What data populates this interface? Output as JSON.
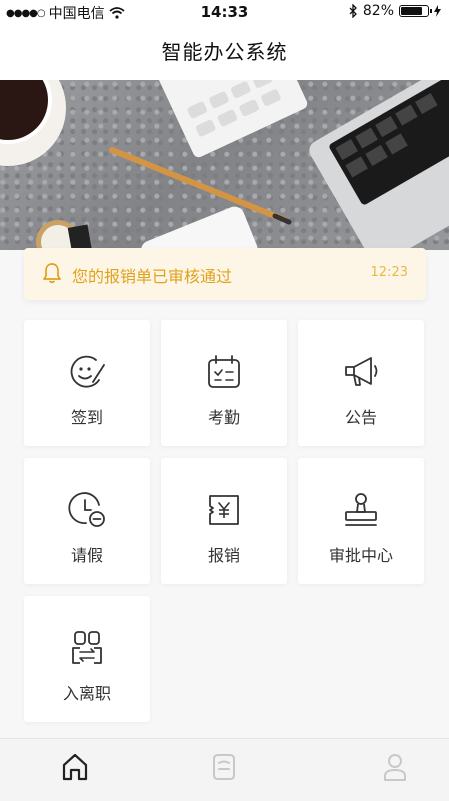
{
  "status_bar": {
    "carrier": "中国电信",
    "time": "14:33",
    "battery_percent": "82%",
    "battery_level": 0.82
  },
  "nav": {
    "title": "智能办公系统"
  },
  "notice": {
    "message": "您的报销单已审核通过",
    "time": "12:23",
    "icon": "bell-icon"
  },
  "menu": {
    "sign_in": "签到",
    "attendance": "考勤",
    "announcement": "公告",
    "leave": "请假",
    "reimbursement": "报销",
    "approval_center": "审批中心",
    "onboarding_offboarding": "入离职"
  },
  "tab_bar": {
    "icons": [
      "home-icon",
      "apps-icon",
      "user-icon"
    ]
  },
  "colors": {
    "notice_text": "#e0a21e",
    "icon_stroke": "#333333",
    "tab_inactive": "#c8c8c8"
  }
}
